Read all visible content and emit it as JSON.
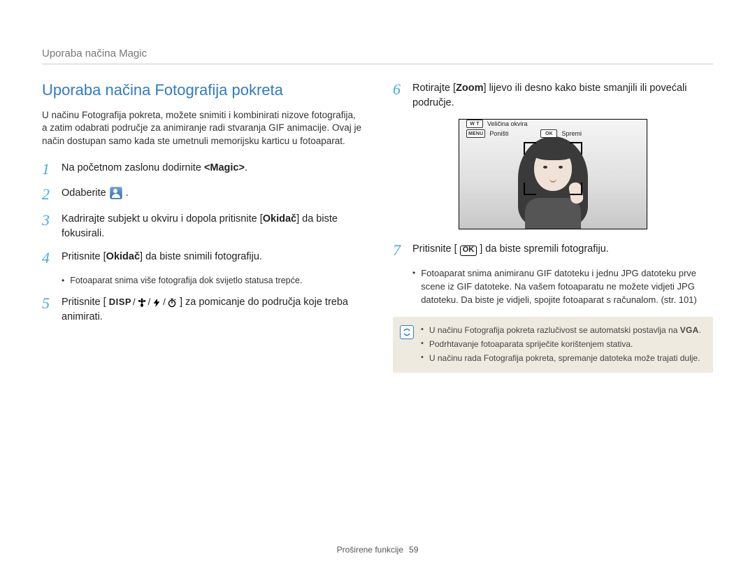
{
  "header": "Uporaba načina Magic",
  "section_title": "Uporaba načina Fotografija pokreta",
  "intro": "U načinu Fotografija pokreta, možete snimiti i kombinirati nizove fotografija, a zatim odabrati područje za animiranje radi stvaranja GIF animacije. Ovaj je način dostupan samo kada ste umetnuli memorijsku karticu u fotoaparat.",
  "left_steps": {
    "s1": {
      "pre": "Na početnom zaslonu dodirnite ",
      "bold": "<Magic>",
      "post": "."
    },
    "s2": {
      "pre": "Odaberite ",
      "post": "."
    },
    "s3": {
      "pre": "Kadrirajte subjekt u okviru i dopola pritisnite [",
      "bold": "Okidač",
      "post": "] da biste fokusirali."
    },
    "s4": {
      "pre": "Pritisnite [",
      "bold": "Okidač",
      "post": "] da biste snimili fotografiju."
    },
    "s4_bullet": "Fotoaparat snima više fotografija dok svijetlo statusa trepće.",
    "s5": {
      "pre": "Pritisnite [",
      "post": "] za pomicanje do područja koje treba animirati."
    }
  },
  "disp_label": "DISP",
  "right_steps": {
    "s6": {
      "pre": "Rotirajte [",
      "bold": "Zoom",
      "post": "] lijevo ili desno kako biste smanjili ili povećali područje."
    },
    "s7": {
      "pre": "Pritisnite [",
      "post": "] da biste spremili fotografiju."
    },
    "s7_bullet": "Fotoaparat snima animiranu GIF datoteku i jednu JPG datoteku prve scene iz GIF datoteke. Na vašem fotoaparatu ne možete vidjeti JPG datoteku. Da biste je vidjeli, spojite fotoaparat s računalom. (str. 101)"
  },
  "ok_label": "OK",
  "screen": {
    "wt_key": "W   T",
    "wt_label": "Veličina okvira",
    "menu_key": "MENU",
    "menu_label": "Poništi",
    "ok_key": "OK",
    "ok_label": "Spremi"
  },
  "info": {
    "b1_pre": "U načinu Fotografija pokreta razlučivost se automatski postavlja na ",
    "b1_vga": "VGA",
    "b1_post": ".",
    "b2": "Podrhtavanje fotoaparata spriječite korištenjem stativa.",
    "b3": "U načinu rada Fotografija pokreta, spremanje datoteka može trajati dulje."
  },
  "footer": {
    "section": "Proširene funkcije",
    "page": "59"
  }
}
